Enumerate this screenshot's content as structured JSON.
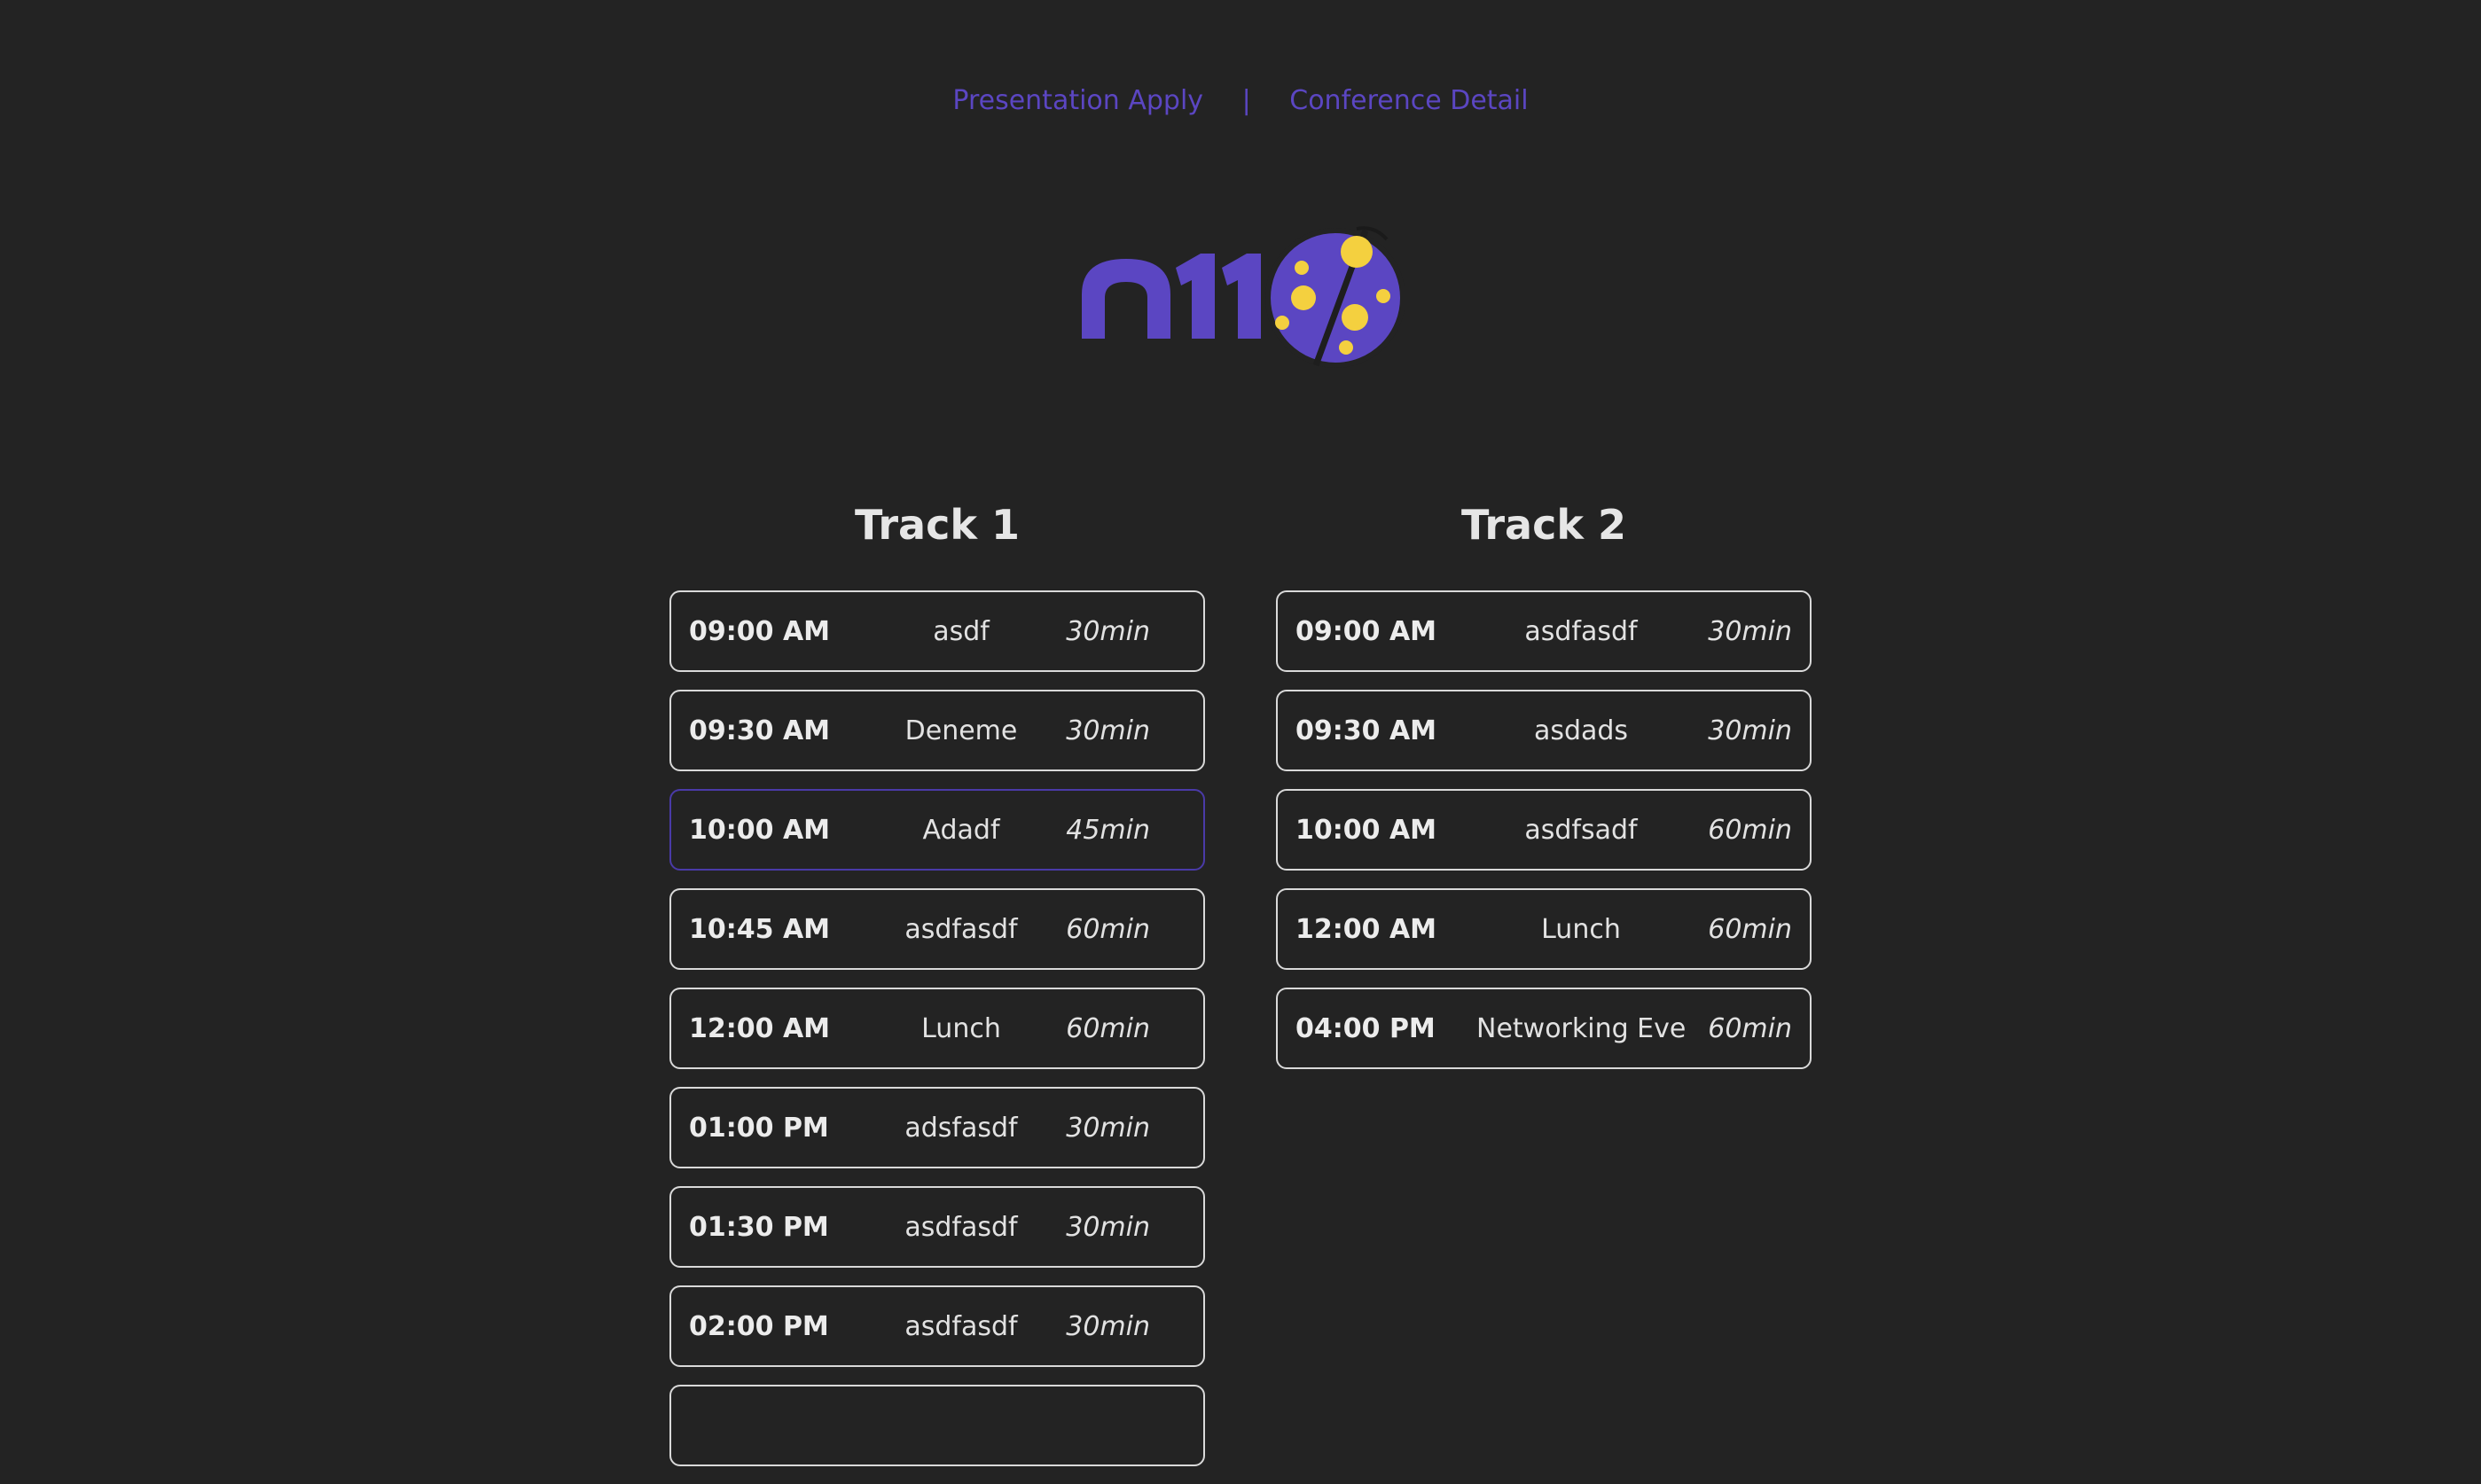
{
  "nav": {
    "presentation_apply": "Presentation Apply",
    "separator": "|",
    "conference_detail": "Conference Detail"
  },
  "logo": {
    "text": "n11",
    "icon": "ladybug-percent-icon",
    "colors": {
      "brand_purple": "#5b46c2",
      "dot_yellow": "#f4d03f"
    }
  },
  "tracks": [
    {
      "title": "Track 1",
      "sessions": [
        {
          "time": "09:00 AM",
          "title": "asdf",
          "duration": "30min"
        },
        {
          "time": "09:30 AM",
          "title": "Deneme",
          "duration": "30min"
        },
        {
          "time": "10:00 AM",
          "title": "Adadf",
          "duration": "45min"
        },
        {
          "time": "10:45 AM",
          "title": "asdfasdf",
          "duration": "60min"
        },
        {
          "time": "12:00 AM",
          "title": "Lunch",
          "duration": "60min"
        },
        {
          "time": "01:00 PM",
          "title": "adsfasdf",
          "duration": "30min"
        },
        {
          "time": "01:30 PM",
          "title": "asdfasdf",
          "duration": "30min"
        },
        {
          "time": "02:00 PM",
          "title": "asdfasdf",
          "duration": "30min"
        }
      ]
    },
    {
      "title": "Track 2",
      "sessions": [
        {
          "time": "09:00 AM",
          "title": "asdfasdf",
          "duration": "30min"
        },
        {
          "time": "09:30 AM",
          "title": "asdads",
          "duration": "30min"
        },
        {
          "time": "10:00 AM",
          "title": "asdfsadf",
          "duration": "60min"
        },
        {
          "time": "12:00 AM",
          "title": "Lunch",
          "duration": "60min"
        },
        {
          "time": "04:00 PM",
          "title": "Networking Event",
          "duration": "60min"
        }
      ]
    }
  ],
  "colors": {
    "background": "#232323",
    "card_border": "#d9d9d9",
    "active_border": "#4a3aa8",
    "link": "#5b46c2"
  }
}
